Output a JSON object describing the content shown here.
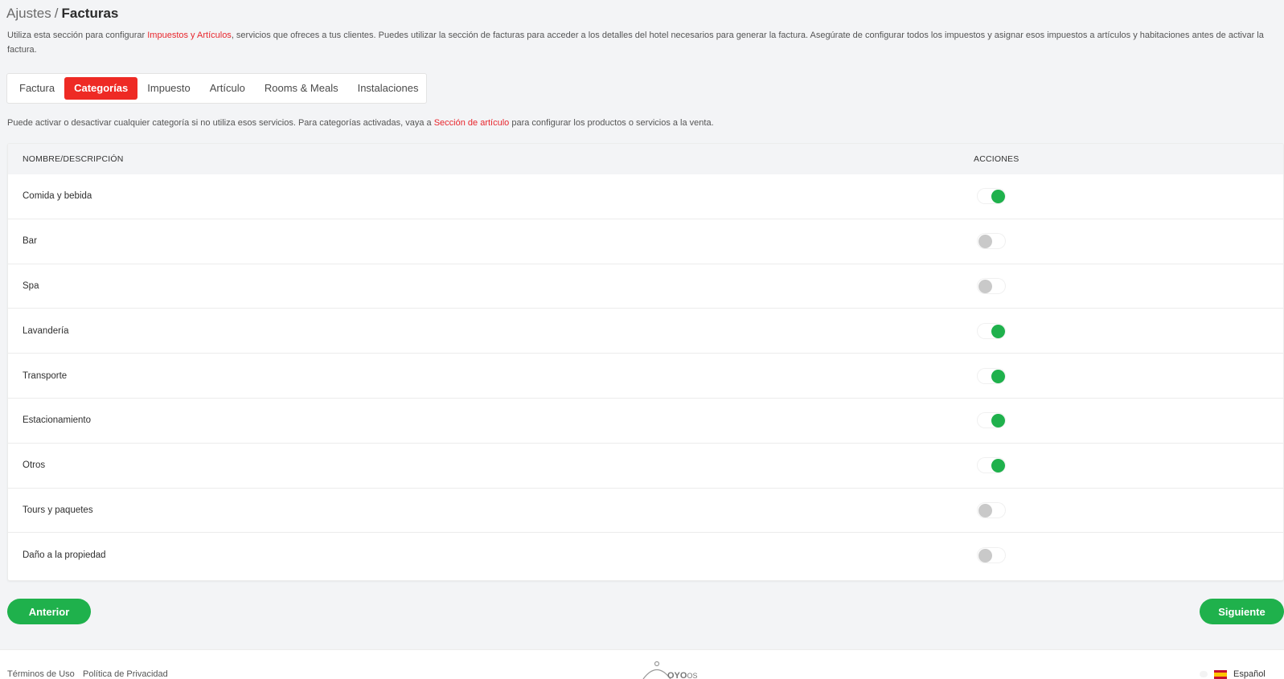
{
  "breadcrumb": {
    "parent": "Ajustes",
    "separator": "/",
    "current": "Facturas"
  },
  "intro": {
    "text_before": "Utiliza esta sección para configurar ",
    "link_taxes": "Impuestos",
    "conj": " y ",
    "link_items": "Artículos",
    "text_after": ", servicios que ofreces a tus clientes. Puedes utilizar la sección de facturas para acceder a los detalles del hotel necesarios para generar la factura. Asegúrate de configurar todos los impuestos y asignar esos impuestos a artículos y habitaciones antes de activar la factura."
  },
  "tabs": [
    {
      "label": "Factura",
      "active": false
    },
    {
      "label": "Categorías",
      "active": true
    },
    {
      "label": "Impuesto",
      "active": false
    },
    {
      "label": "Artículo",
      "active": false
    },
    {
      "label": "Rooms & Meals",
      "active": false
    },
    {
      "label": "Instalaciones",
      "active": false
    }
  ],
  "helper": {
    "text_before": "Puede activar o desactivar cualquier categoría si no utiliza esos servicios. Para categorías activadas, vaya a ",
    "link": "Sección de artículo",
    "text_after": " para configurar los productos o servicios a la venta."
  },
  "table": {
    "col_name": "NOMBRE/DESCRIPCIÓN",
    "col_actions": "ACCIONES",
    "rows": [
      {
        "label": "Comida y bebida",
        "enabled": true
      },
      {
        "label": "Bar",
        "enabled": false
      },
      {
        "label": "Spa",
        "enabled": false
      },
      {
        "label": "Lavandería",
        "enabled": true
      },
      {
        "label": "Transporte",
        "enabled": true
      },
      {
        "label": "Estacionamiento",
        "enabled": true
      },
      {
        "label": "Otros",
        "enabled": true
      },
      {
        "label": "Tours y paquetes",
        "enabled": false
      },
      {
        "label": "Daño a la propiedad",
        "enabled": false
      }
    ]
  },
  "buttons": {
    "prev": "Anterior",
    "next": "Siguiente"
  },
  "footer": {
    "terms": "Términos de Uso",
    "privacy": "Política de Privacidad",
    "logo_text": "OYO",
    "logo_suffix": "OS",
    "language": "Español"
  },
  "colors": {
    "accent_red": "#ee2a24",
    "toggle_on": "#1fb14c",
    "toggle_off": "#c9c9c9",
    "button_green": "#1fb14c"
  }
}
